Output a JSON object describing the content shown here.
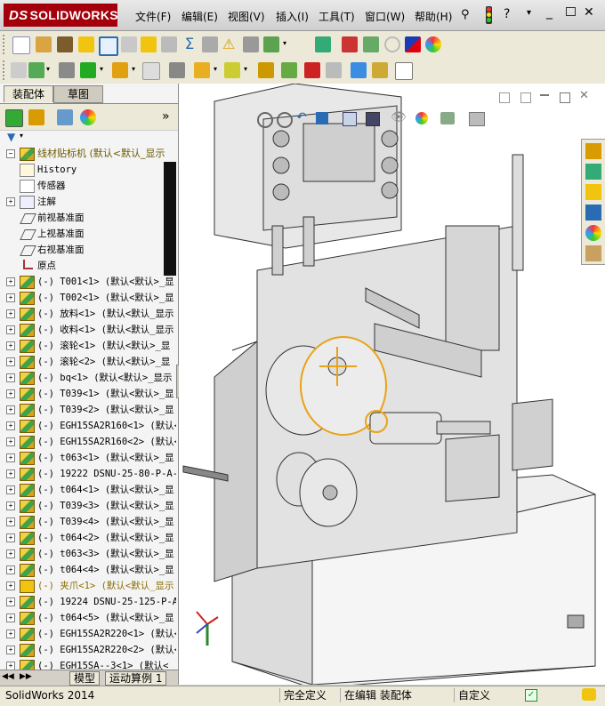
{
  "app": {
    "brand": "SOLIDWORKS",
    "brand_prefix": "DS"
  },
  "menu": [
    "文件(F)",
    "编辑(E)",
    "视图(V)",
    "插入(I)",
    "工具(T)",
    "窗口(W)",
    "帮助(H)"
  ],
  "panel_tabs": [
    "装配体",
    "草图"
  ],
  "tree": {
    "root": "线材贴标机  (默认<默认_显示",
    "items": [
      {
        "exp": "",
        "label": "History",
        "icon": "history-icon"
      },
      {
        "exp": "",
        "label": "传感器",
        "icon": "sensor-icon"
      },
      {
        "exp": "+",
        "label": "注解",
        "icon": "annotation-icon"
      },
      {
        "exp": "",
        "label": "前视基准面",
        "icon": "plane-icon"
      },
      {
        "exp": "",
        "label": "上视基准面",
        "icon": "plane-icon"
      },
      {
        "exp": "",
        "label": "右视基准面",
        "icon": "plane-icon"
      },
      {
        "exp": "",
        "label": "原点",
        "icon": "origin-icon"
      },
      {
        "exp": "+",
        "label": "(-) T001<1> (默认<默认>_显",
        "icon": "part-icon"
      },
      {
        "exp": "+",
        "label": "(-) T002<1> (默认<默认>_显",
        "icon": "part-icon"
      },
      {
        "exp": "+",
        "label": "(-) 放料<1> (默认<默认_显示",
        "icon": "part-icon"
      },
      {
        "exp": "+",
        "label": "(-) 收料<1> (默认<默认_显示",
        "icon": "part-icon"
      },
      {
        "exp": "+",
        "label": "(-) 滚轮<1> (默认<默认>_显",
        "icon": "part-icon"
      },
      {
        "exp": "+",
        "label": "(-) 滚轮<2> (默认<默认>_显",
        "icon": "part-icon"
      },
      {
        "exp": "+",
        "label": "(-) bq<1> (默认<默认>_显示",
        "icon": "part-icon"
      },
      {
        "exp": "+",
        "label": "(-) T039<1> (默认<默认>_显",
        "icon": "part-icon"
      },
      {
        "exp": "+",
        "label": "(-) T039<2> (默认<默认>_显",
        "icon": "part-icon"
      },
      {
        "exp": "+",
        "label": "(-) EGH15SA2R160<1> (默认<",
        "icon": "part-icon"
      },
      {
        "exp": "+",
        "label": "(-) EGH15SA2R160<2> (默认<",
        "icon": "part-icon"
      },
      {
        "exp": "+",
        "label": "(-) t063<1> (默认<默认>_显",
        "icon": "part-icon"
      },
      {
        "exp": "+",
        "label": "(-) 19222 DSNU-25-80-P-A-",
        "icon": "part-icon"
      },
      {
        "exp": "+",
        "label": "(-) t064<1> (默认<默认>_显",
        "icon": "part-icon"
      },
      {
        "exp": "+",
        "label": "(-) T039<3> (默认<默认>_显",
        "icon": "part-icon"
      },
      {
        "exp": "+",
        "label": "(-) T039<4> (默认<默认>_显",
        "icon": "part-icon"
      },
      {
        "exp": "+",
        "label": "(-) t064<2> (默认<默认>_显",
        "icon": "part-icon"
      },
      {
        "exp": "+",
        "label": "(-) t063<3> (默认<默认>_显",
        "icon": "part-icon"
      },
      {
        "exp": "+",
        "label": "(-) t064<4> (默认<默认>_显",
        "icon": "part-icon"
      },
      {
        "exp": "+",
        "label": "(-) 夹爪<1> (默认<默认_显示",
        "icon": "warning-icon"
      },
      {
        "exp": "+",
        "label": "(-) 19224 DSNU-25-125-P-A-",
        "icon": "part-icon"
      },
      {
        "exp": "+",
        "label": "(-) t064<5> (默认<默认>_显",
        "icon": "part-icon"
      },
      {
        "exp": "+",
        "label": "(-) EGH15SA2R220<1> (默认<",
        "icon": "part-icon"
      },
      {
        "exp": "+",
        "label": "(-) EGH15SA2R220<2> (默认<",
        "icon": "part-icon"
      },
      {
        "exp": "+",
        "label": "(-) EGH15SA--3<1> (默认<",
        "icon": "part-icon"
      }
    ]
  },
  "bottom_tabs": [
    "模型",
    "运动算例 1"
  ],
  "status": {
    "app_version": "SolidWorks 2014",
    "defined": "完全定义",
    "editing": "在编辑 装配体",
    "custom": "自定义"
  },
  "colors": {
    "brand_red": "#a3000b",
    "warning_yellow": "#f1c40f",
    "selection_orange": "#e8a317"
  }
}
